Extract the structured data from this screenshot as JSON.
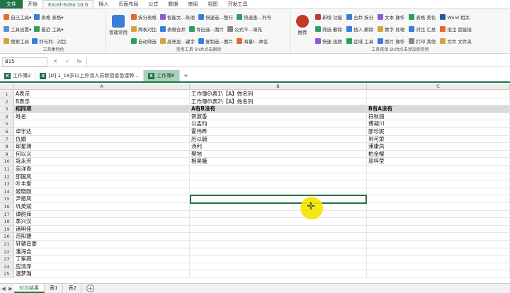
{
  "menu": [
    "文件",
    "开始",
    "Excel-SoSo 10.0",
    "插入",
    "页面布局",
    "公式",
    "数据",
    "审阅",
    "视图",
    "开发工具"
  ],
  "ribbon": {
    "g1": {
      "rows": [
        [
          "自己工具▾",
          "表格",
          "表格▾"
        ],
        [
          "工具设置▾",
          "最近",
          "工具▾"
        ],
        [
          "搜索工具",
          "列与列…对比"
        ]
      ],
      "label": "工具集特色"
    },
    "g2": {
      "big": "管理常用",
      "rows": [
        [
          "拆分表格",
          "智能文…处理",
          "快速选…整行",
          "快速查…列号"
        ],
        [
          "两表对比",
          "表格合并",
          "导出选…图片",
          "公式不…填充"
        ],
        [
          "自动筛选",
          "高亮显…键字",
          "复制选…图片",
          "海量I…命名"
        ]
      ],
      "label": "常用工具 Shift点击删除"
    },
    "g3": {
      "big": "推荐",
      "rows": [
        [
          "新增 功能",
          "合并 拆分",
          "文本 操作",
          "表格 美化",
          "Word 相关"
        ],
        [
          "筛选 删除",
          "插入 删除",
          "数字 处理",
          "对比 汇总",
          "批注 超链接"
        ],
        [
          "快速 函数",
          "区域 工具",
          "图片 操作",
          "打印 其他",
          "文件 文件夹"
        ]
      ],
      "label": "工具菜单 Shift点击添加到常用"
    }
  },
  "namebox": "B15",
  "fx": "fx",
  "doctabs": [
    "工作簿2",
    "[D] 1_18岁以上外流人员新冠疫苗接种...",
    "工作簿6"
  ],
  "columns": [
    "A",
    "B",
    "C"
  ],
  "rows": [
    {
      "n": "1",
      "a": "A表示",
      "b": "工作簿6\\表1\\【A】姓名列",
      "c": "",
      "h": false
    },
    {
      "n": "2",
      "a": "B表示",
      "b": "工作簿6\\表2\\【A】姓名列",
      "c": "",
      "h": false
    },
    {
      "n": "3",
      "a": "相同项",
      "b": "A有B没有",
      "c": "B有A没有",
      "h": true
    },
    {
      "n": "4",
      "a": "姓名",
      "b": "贺淑香",
      "c": "符秋丽",
      "h": false
    },
    {
      "n": "5",
      "a": "",
      "b": "公孟钧",
      "c": "傅凝川",
      "h": false
    },
    {
      "n": "6",
      "a": "卓宇达",
      "b": "霍伟晔",
      "c": "邵珍妮",
      "h": false
    },
    {
      "n": "7",
      "a": "仇娟",
      "b": "历以毓",
      "c": "到可荣",
      "h": false
    },
    {
      "n": "8",
      "a": "邱星渊",
      "b": "汤利",
      "c": "浦康凤",
      "h": false
    },
    {
      "n": "9",
      "a": "何以义",
      "b": "樊地",
      "c": "柏金樱",
      "h": false
    },
    {
      "n": "10",
      "a": "寇永芳",
      "b": "相昊娥",
      "c": "邢梓莹",
      "h": false
    },
    {
      "n": "11",
      "a": "宛洋青",
      "b": "",
      "c": "",
      "h": false
    },
    {
      "n": "12",
      "a": "邵国凤",
      "b": "",
      "c": "",
      "h": false
    },
    {
      "n": "13",
      "a": "叶丰爱",
      "b": "",
      "c": "",
      "h": false
    },
    {
      "n": "14",
      "a": "姬晓刚",
      "b": "",
      "c": "",
      "h": false
    },
    {
      "n": "15",
      "a": "尹振凤",
      "b": "",
      "c": "",
      "h": false
    },
    {
      "n": "16",
      "a": "巩英斌",
      "b": "",
      "c": "",
      "h": false
    },
    {
      "n": "17",
      "a": "谭韵茹",
      "b": "",
      "c": "",
      "h": false
    },
    {
      "n": "18",
      "a": "季兴汉",
      "b": "",
      "c": "",
      "h": false
    },
    {
      "n": "19",
      "a": "诸明佳",
      "b": "",
      "c": "",
      "h": false
    },
    {
      "n": "20",
      "a": "范阳捷",
      "b": "",
      "c": "",
      "h": false
    },
    {
      "n": "21",
      "a": "轩辕音豪",
      "b": "",
      "c": "",
      "h": false
    },
    {
      "n": "22",
      "a": "潘海含",
      "b": "",
      "c": "",
      "h": false
    },
    {
      "n": "23",
      "a": "丁紫薇",
      "b": "",
      "c": "",
      "h": false
    },
    {
      "n": "24",
      "a": "应清泽",
      "b": "",
      "c": "",
      "h": false
    },
    {
      "n": "25",
      "a": "温梦瀚",
      "b": "",
      "c": "",
      "h": false
    }
  ],
  "sheets": [
    "对比结果",
    "表1",
    "表2"
  ],
  "nav": [
    "◀",
    "▶"
  ],
  "addsheet": "+"
}
